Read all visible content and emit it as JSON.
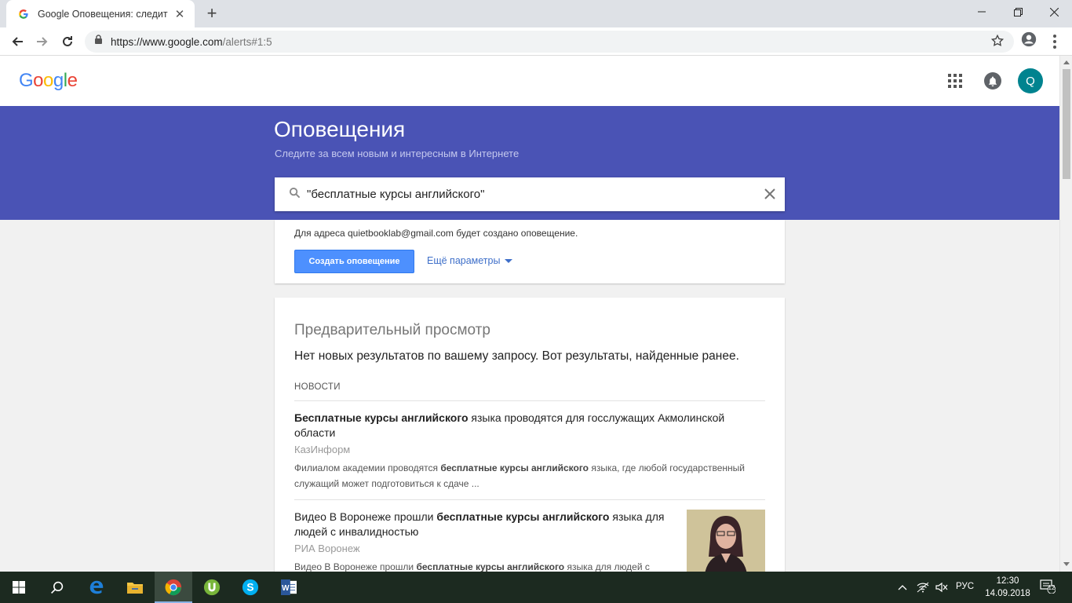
{
  "browser": {
    "tab_title": "Google Оповещения: следите за",
    "url_host": "https://www.google.com",
    "url_path": "/alerts#1:5"
  },
  "google": {
    "logo_letters": [
      "G",
      "o",
      "o",
      "g",
      "l",
      "e"
    ],
    "logo_colors": [
      "#4285f4",
      "#ea4335",
      "#fbbc05",
      "#4285f4",
      "#34a853",
      "#ea4335"
    ],
    "avatar_letter": "Q"
  },
  "banner": {
    "title": "Оповещения",
    "subtitle": "Следите за всем новым и интересным в Интернете",
    "search_value": "\"бесплатные курсы английского\""
  },
  "create": {
    "note": "Для адреса quietbooklab@gmail.com будет создано оповещение.",
    "button_label": "Создать оповещение",
    "more_options": "Ещё параметры"
  },
  "preview": {
    "title": "Предварительный просмотр",
    "note": "Нет новых результатов по вашему запросу. Вот результаты, найденные ранее.",
    "section": "НОВОСТИ",
    "items": [
      {
        "title_bold": "Бесплатные курсы английского",
        "title_rest": " языка проводятся для госслужащих Акмолинской области",
        "source": "КазИнформ",
        "snippet_pre": "Филиалом академии проводятся ",
        "snippet_bold": "бесплатные курсы английского",
        "snippet_post": " языка, где любой государственный служащий может подготовиться к сдаче ..."
      },
      {
        "title_pre": "Видео В Воронеже прошли ",
        "title_bold": "бесплатные курсы английского",
        "title_rest": " языка для людей с инвалидностью",
        "source": "РИА Воронеж",
        "snippet_pre": "Видео В Воронеже прошли ",
        "snippet_bold": "бесплатные курсы английского",
        "snippet_post": " языка для людей с"
      }
    ]
  },
  "taskbar": {
    "language": "РУС",
    "time": "12:30",
    "date": "14.09.2018",
    "notification_count": "12"
  },
  "colors": {
    "banner": "#4a53b5",
    "primary_button": "#4d90fe",
    "link": "#3e6fc9",
    "avatar": "#00838f"
  }
}
